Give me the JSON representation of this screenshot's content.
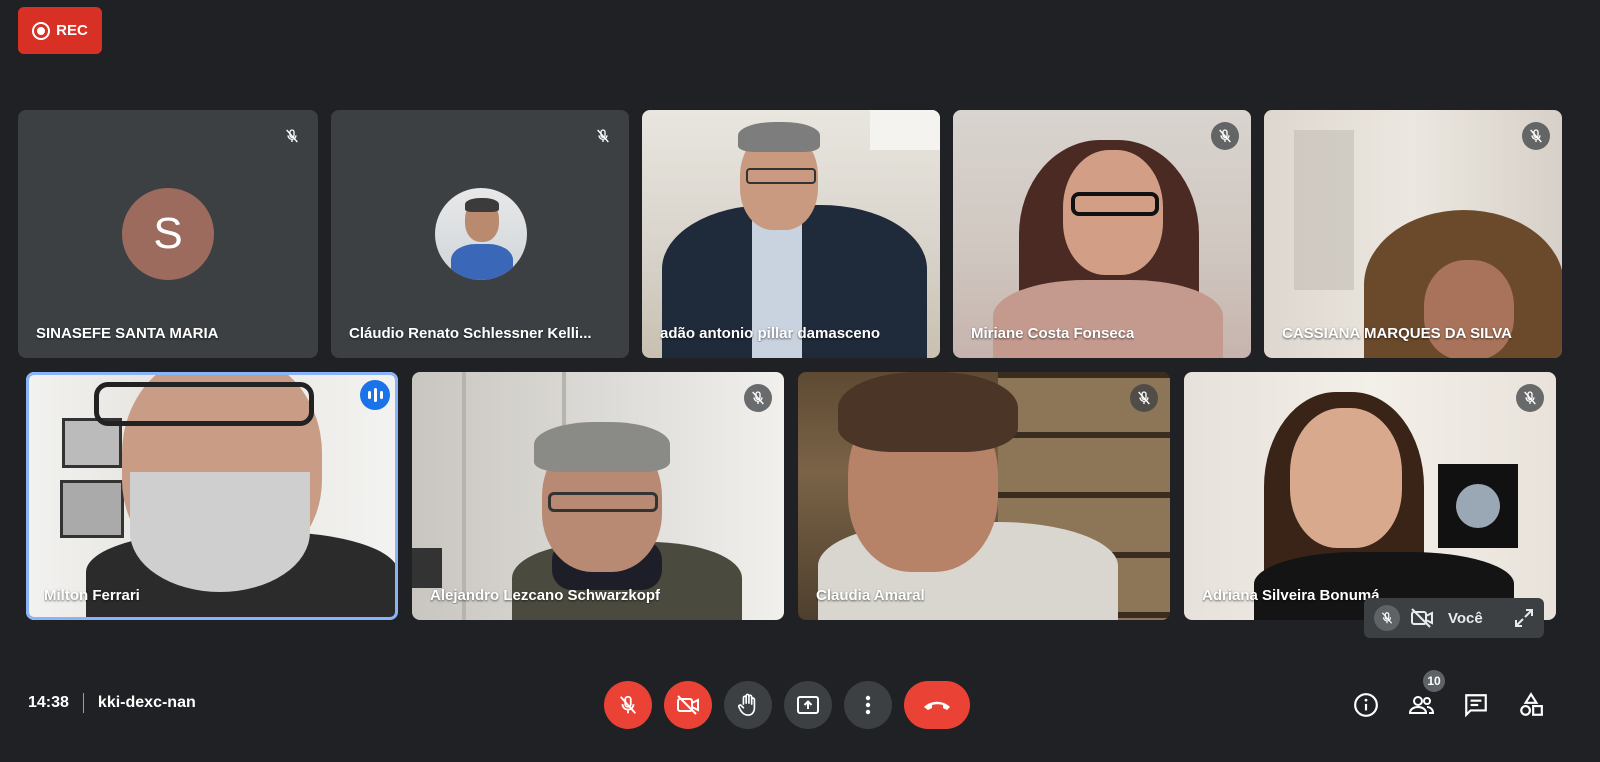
{
  "recording": {
    "label": "REC"
  },
  "participants": [
    {
      "name": "SINASEFE SANTA MARIA",
      "avatar_letter": "S"
    },
    {
      "name": "Cláudio Renato Schlessner Kelli..."
    },
    {
      "name": "adão antonio pillar damasceno"
    },
    {
      "name": "Miriane Costa Fonseca"
    },
    {
      "name": "CASSIANA MARQUES DA SILVA"
    },
    {
      "name": "Milton Ferrari"
    },
    {
      "name": "Alejandro Lezcano Schwarzkopf"
    },
    {
      "name": "Claudia Amaral"
    },
    {
      "name": "Adriana Silveira Bonumá"
    }
  ],
  "self_view": {
    "label": "Você"
  },
  "meeting": {
    "time": "14:38",
    "code": "kki-dexc-nan"
  },
  "people_count": "10",
  "colors": {
    "background": "#202124",
    "tile": "#3c4043",
    "danger": "#ea4335",
    "speaking": "#1a73e8"
  }
}
